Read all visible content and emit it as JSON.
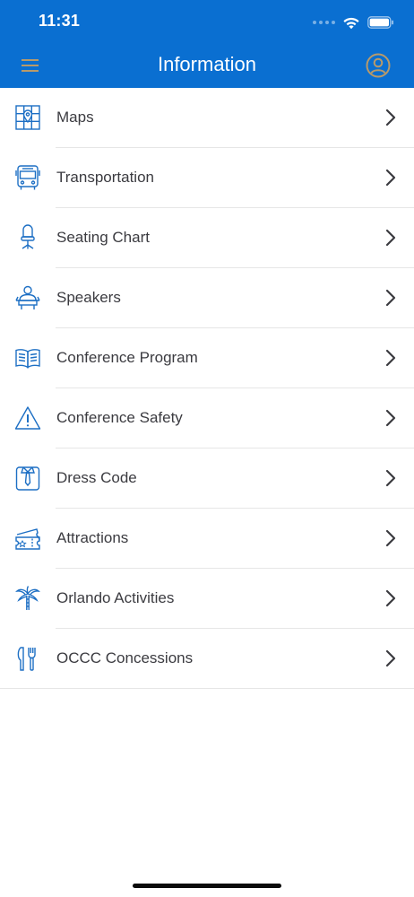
{
  "status_bar": {
    "time": "11:31"
  },
  "header": {
    "title": "Information",
    "background_color": "#0a6fd1",
    "menu_icon": "hamburger-menu-icon",
    "profile_icon": "user-profile-icon",
    "icon_color": "#b89a6a"
  },
  "list": {
    "icon_color": "#1d6fc4",
    "items": [
      {
        "label": "Maps",
        "icon": "map-icon"
      },
      {
        "label": "Transportation",
        "icon": "bus-icon"
      },
      {
        "label": "Seating Chart",
        "icon": "chair-icon"
      },
      {
        "label": "Speakers",
        "icon": "speaker-podium-icon"
      },
      {
        "label": "Conference Program",
        "icon": "open-book-icon"
      },
      {
        "label": "Conference Safety",
        "icon": "warning-triangle-icon"
      },
      {
        "label": "Dress Code",
        "icon": "shirt-tie-icon"
      },
      {
        "label": "Attractions",
        "icon": "ticket-icon"
      },
      {
        "label": "Orlando Activities",
        "icon": "palm-tree-icon"
      },
      {
        "label": "OCCC Concessions",
        "icon": "fork-knife-icon"
      }
    ]
  }
}
